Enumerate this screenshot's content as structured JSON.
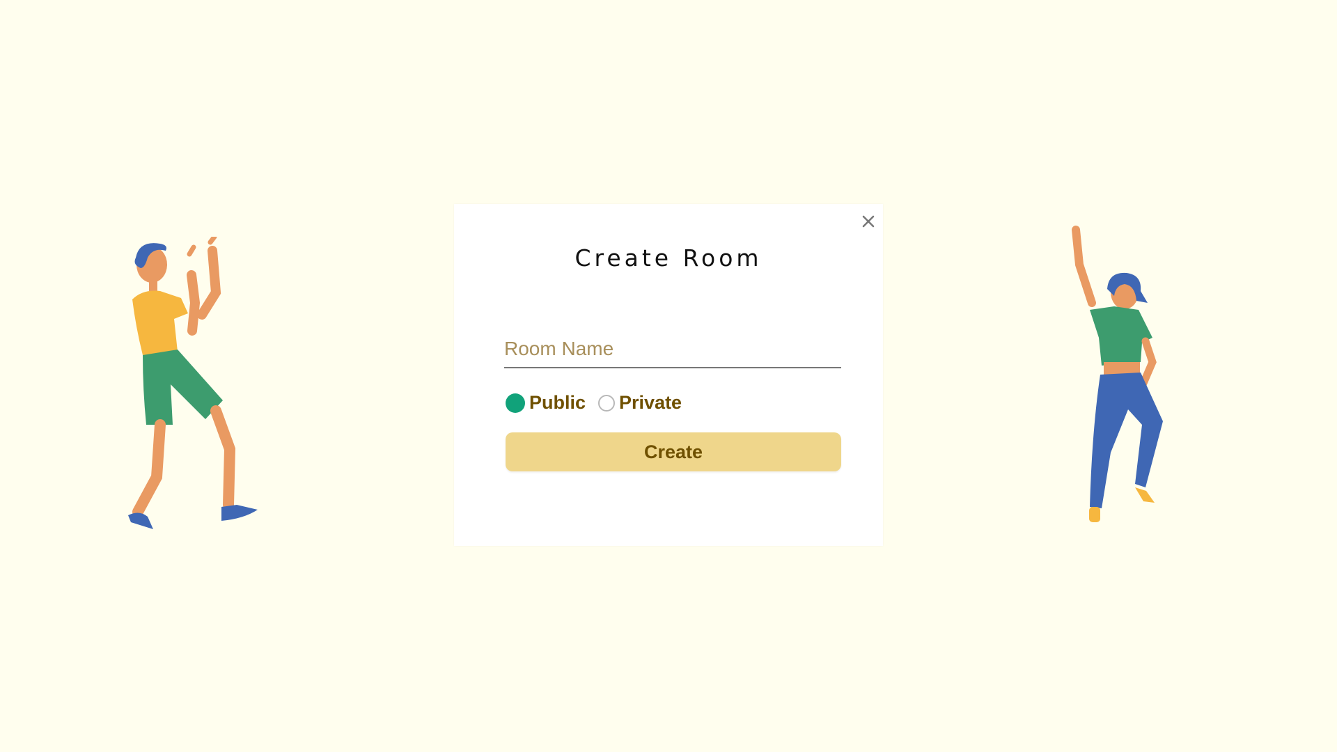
{
  "modal": {
    "title": "Create Room",
    "room_name": {
      "value": "",
      "placeholder": "Room Name"
    },
    "visibility": {
      "options": [
        {
          "label": "Public",
          "selected": true
        },
        {
          "label": "Private",
          "selected": false
        }
      ]
    },
    "create_label": "Create",
    "close_icon": "close-icon"
  },
  "illustrations": {
    "left": "dancing-man-illustration",
    "right": "dancing-woman-illustration"
  },
  "colors": {
    "background": "#fffeee",
    "accent_green": "#11a27a",
    "button_fill": "#efd68b",
    "label_brown": "#6f5000",
    "placeholder": "#a88f5b"
  }
}
